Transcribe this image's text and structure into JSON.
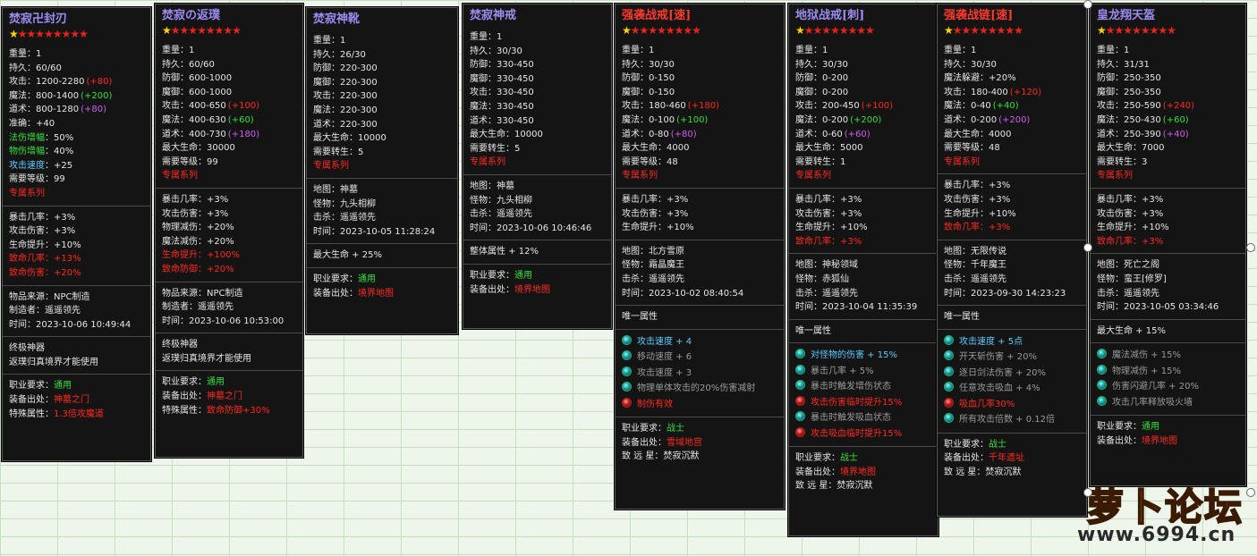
{
  "cards": [
    {
      "name": "焚寂卍封刃",
      "title_color": "purple",
      "stars": 9,
      "base": [
        {
          "k": "重量",
          "v": "1"
        },
        {
          "k": "持久",
          "v": "60/60"
        },
        {
          "k": "攻击",
          "v": "1200-2280",
          "b": "(+80)",
          "bc": "r"
        },
        {
          "k": "魔法",
          "v": "800-1400",
          "b": "(+200)",
          "bc": "g"
        },
        {
          "k": "道术",
          "v": "800-1280",
          "b": "(+80)",
          "bc": "p"
        },
        {
          "k": "准确",
          "v": "+40"
        },
        {
          "k": "法伤增幅",
          "v": "50%",
          "kc": "g"
        },
        {
          "k": "物伤增幅",
          "v": "40%",
          "kc": "g"
        },
        {
          "k": "攻击速度",
          "v": "+25",
          "kc": "c"
        },
        {
          "k": "需要等级",
          "v": "99"
        }
      ],
      "series": "专属系列",
      "bonus": [
        {
          "t": "暴击几率：+3%"
        },
        {
          "t": "攻击伤害：+3%"
        },
        {
          "t": "生命提升：+10%"
        },
        {
          "t": "致命几率：+13%",
          "c": "r"
        },
        {
          "t": "致命伤害：+20%",
          "c": "r"
        }
      ],
      "source": [
        "物品来源：NPC制造",
        "制造者：遥遥领先",
        "时间：2023-10-06 10:49:44"
      ],
      "extra": [
        "终极神器",
        "返璞归真境界才能使用"
      ],
      "req": [
        {
          "k": "职业要求：",
          "v": "通用",
          "c": "g"
        },
        {
          "k": "装备出处：",
          "v": "神墓之门",
          "c": "r"
        },
        {
          "k": "特殊属性：",
          "v": "1.3倍攻魔道",
          "c": "r"
        }
      ]
    },
    {
      "name": "焚寂の返璞",
      "title_color": "purple",
      "stars": 9,
      "base": [
        {
          "k": "重量",
          "v": "1"
        },
        {
          "k": "持久",
          "v": "60/60"
        },
        {
          "k": "防御",
          "v": "600-1000"
        },
        {
          "k": "魔御",
          "v": "600-1000"
        },
        {
          "k": "攻击",
          "v": "400-650",
          "b": "(+100)",
          "bc": "r"
        },
        {
          "k": "魔法",
          "v": "400-630",
          "b": "(+60)",
          "bc": "g"
        },
        {
          "k": "道术",
          "v": "400-730",
          "b": "(+180)",
          "bc": "p"
        },
        {
          "k": "最大生命",
          "v": "30000"
        },
        {
          "k": "需要等级",
          "v": "99"
        }
      ],
      "series": "专属系列",
      "bonus": [
        {
          "t": "暴击几率：+3%"
        },
        {
          "t": "攻击伤害：+3%"
        },
        {
          "t": "物理减伤：+20%"
        },
        {
          "t": "魔法减伤：+20%"
        },
        {
          "t": "生命提升：+100%",
          "c": "r"
        },
        {
          "t": "致命防御：+20%",
          "c": "r"
        }
      ],
      "source": [
        "物品来源：NPC制造",
        "制造者：遥遥领先",
        "时间：2023-10-06 10:53:00"
      ],
      "extra": [
        "终极神器",
        "返璞归真境界才能使用"
      ],
      "req": [
        {
          "k": "职业要求：",
          "v": "通用",
          "c": "g"
        },
        {
          "k": "装备出处：",
          "v": "神墓之门",
          "c": "r"
        },
        {
          "k": "特殊属性：",
          "v": "致命防御+30%",
          "c": "r"
        }
      ]
    },
    {
      "name": "焚寂神靴",
      "title_color": "purple",
      "stars": 0,
      "base": [
        {
          "k": "重量",
          "v": "1"
        },
        {
          "k": "持久",
          "v": "26/30"
        },
        {
          "k": "防御",
          "v": "220-300"
        },
        {
          "k": "魔御",
          "v": "220-300"
        },
        {
          "k": "攻击",
          "v": "220-300"
        },
        {
          "k": "魔法",
          "v": "220-300"
        },
        {
          "k": "道术",
          "v": "220-300"
        },
        {
          "k": "最大生命",
          "v": "10000"
        },
        {
          "k": "需要转生",
          "v": "5"
        }
      ],
      "series": "专属系列",
      "source": [
        "地图：神墓",
        "怪物：九头相柳",
        "击杀：遥遥领先",
        "时间：2023-10-05 11:28:24"
      ],
      "extra": [
        "最大生命 + 25%"
      ],
      "req": [
        {
          "k": "职业要求：",
          "v": "通用",
          "c": "g"
        },
        {
          "k": "装备出处：",
          "v": "境界地图",
          "c": "r"
        }
      ]
    },
    {
      "name": "焚寂神戒",
      "title_color": "purple",
      "stars": 0,
      "base": [
        {
          "k": "重量",
          "v": "1"
        },
        {
          "k": "持久",
          "v": "30/30"
        },
        {
          "k": "防御",
          "v": "330-450"
        },
        {
          "k": "魔御",
          "v": "330-450"
        },
        {
          "k": "攻击",
          "v": "330-450"
        },
        {
          "k": "魔法",
          "v": "330-450"
        },
        {
          "k": "道术",
          "v": "330-450"
        },
        {
          "k": "最大生命",
          "v": "10000"
        },
        {
          "k": "需要转生",
          "v": "5"
        }
      ],
      "series": "专属系列",
      "source": [
        "地图：神墓",
        "怪物：九头相柳",
        "击杀：遥遥领先",
        "时间：2023-10-06 10:46:46"
      ],
      "extra": [
        "整体属性 + 12%"
      ],
      "req": [
        {
          "k": "职业要求：",
          "v": "通用",
          "c": "g"
        },
        {
          "k": "装备出处：",
          "v": "境界地图",
          "c": "r"
        }
      ]
    },
    {
      "name": "强袭战戒[速]",
      "title_color": "red",
      "stars": 9,
      "base": [
        {
          "k": "重量",
          "v": "1"
        },
        {
          "k": "持久",
          "v": "30/30"
        },
        {
          "k": "防御",
          "v": "0-150"
        },
        {
          "k": "魔御",
          "v": "0-150"
        },
        {
          "k": "攻击",
          "v": "180-460",
          "b": "(+180)",
          "bc": "r"
        },
        {
          "k": "魔法",
          "v": "0-100",
          "b": "(+100)",
          "bc": "g"
        },
        {
          "k": "道术",
          "v": "0-80",
          "b": "(+80)",
          "bc": "p"
        },
        {
          "k": "最大生命",
          "v": "4000"
        },
        {
          "k": "需要等级",
          "v": "48"
        }
      ],
      "series": "专属系列",
      "bonus": [
        {
          "t": "暴击几率：+3%"
        },
        {
          "t": "攻击伤害：+3%"
        },
        {
          "t": "生命提升：+10%"
        }
      ],
      "source": [
        "地图：北方雪原",
        "怪物：霜晶魔王",
        "击杀：遥遥领先",
        "时间：2023-10-02 08:40:54"
      ],
      "unique_label": "唯一属性",
      "unique": [
        {
          "t": "攻击速度 + 4",
          "c": "c"
        },
        {
          "t": "移动速度 + 6",
          "c": "gr"
        },
        {
          "t": "攻击速度 + 3",
          "c": "gr"
        },
        {
          "t": "物理单体攻击的20%伤害减射",
          "c": "gr"
        },
        {
          "t": "制伤有效",
          "c": "r",
          "dot": "rd"
        }
      ],
      "req": [
        {
          "k": "职业要求：",
          "v": "战士",
          "c": "g"
        },
        {
          "k": "装备出处：",
          "v": "雪域地宫",
          "c": "r"
        },
        {
          "k": "致 远 星：",
          "v": "焚寂沉默",
          "c": "w"
        }
      ]
    },
    {
      "name": "地狱战戒[刺]",
      "title_color": "purple",
      "stars": 9,
      "base": [
        {
          "k": "重量",
          "v": "1"
        },
        {
          "k": "持久",
          "v": "30/30"
        },
        {
          "k": "防御",
          "v": "0-200"
        },
        {
          "k": "魔御",
          "v": "0-200"
        },
        {
          "k": "攻击",
          "v": "200-450",
          "b": "(+100)",
          "bc": "r"
        },
        {
          "k": "魔法",
          "v": "0-200",
          "b": "(+200)",
          "bc": "g"
        },
        {
          "k": "道术",
          "v": "0-60",
          "b": "(+60)",
          "bc": "p"
        },
        {
          "k": "最大生命",
          "v": "5000"
        },
        {
          "k": "需要转生",
          "v": "1"
        }
      ],
      "series": "专属系列",
      "bonus": [
        {
          "t": "暴击几率：+3%"
        },
        {
          "t": "攻击伤害：+3%"
        },
        {
          "t": "生命提升：+10%"
        },
        {
          "t": "致命几率：+3%",
          "c": "r"
        }
      ],
      "source": [
        "地图：神秘领域",
        "怪物：赤狐仙",
        "击杀：遥遥领先",
        "时间：2023-10-04 11:35:39"
      ],
      "unique_label": "唯一属性",
      "unique": [
        {
          "t": "对怪物的伤害 + 15%",
          "c": "c"
        },
        {
          "t": "暴击几率 + 5%",
          "c": "gr"
        },
        {
          "t": "暴击时触发增伤状态",
          "c": "gr"
        },
        {
          "t": "攻击伤害临时提升15%",
          "c": "r",
          "dot": "rd"
        },
        {
          "t": "暴击时触发吸血状态",
          "c": "gr"
        },
        {
          "t": "攻击吸血临时提升15%",
          "c": "r",
          "dot": "rd"
        }
      ],
      "req": [
        {
          "k": "职业要求：",
          "v": "战士",
          "c": "g"
        },
        {
          "k": "装备出处：",
          "v": "境界地图",
          "c": "r"
        },
        {
          "k": "致 远 星：",
          "v": "焚寂沉默",
          "c": "w"
        }
      ]
    },
    {
      "name": "强袭战链[速]",
      "title_color": "red",
      "stars": 9,
      "base": [
        {
          "k": "重量",
          "v": "1"
        },
        {
          "k": "持久",
          "v": "30/30"
        },
        {
          "k": "魔法躲避",
          "v": "+20%"
        },
        {
          "k": "攻击",
          "v": "180-400",
          "b": "(+120)",
          "bc": "r"
        },
        {
          "k": "魔法",
          "v": "0-40",
          "b": "(+40)",
          "bc": "g"
        },
        {
          "k": "道术",
          "v": "0-200",
          "b": "(+200)",
          "bc": "p"
        },
        {
          "k": "最大生命",
          "v": "4000"
        },
        {
          "k": "需要等级",
          "v": "48"
        }
      ],
      "series": "专属系列",
      "bonus": [
        {
          "t": "暴击几率：+3%"
        },
        {
          "t": "攻击伤害：+3%"
        },
        {
          "t": "生命提升：+10%"
        },
        {
          "t": "致命几率：+3%",
          "c": "r"
        }
      ],
      "source": [
        "地图：无限传说",
        "怪物：千年魔王",
        "击杀：遥遥领先",
        "时间：2023-09-30 14:23:23"
      ],
      "unique_label": "唯一属性",
      "unique": [
        {
          "t": "攻击速度 + 5点",
          "c": "c"
        },
        {
          "t": "开天斩伤害 + 20%",
          "c": "gr"
        },
        {
          "t": "逐日剑法伤害 + 20%",
          "c": "gr"
        },
        {
          "t": "任意攻击吸血 + 4%",
          "c": "gr"
        },
        {
          "t": "吸血几率30%",
          "c": "r",
          "dot": "rd"
        },
        {
          "t": "所有攻击倍数 + 0.12倍",
          "c": "gr"
        }
      ],
      "req": [
        {
          "k": "职业要求：",
          "v": "战士",
          "c": "g"
        },
        {
          "k": "装备出处：",
          "v": "千年遗址",
          "c": "r"
        },
        {
          "k": "致 远 星：",
          "v": "焚寂沉默",
          "c": "w"
        }
      ]
    },
    {
      "name": "皇龙翔天盔",
      "title_color": "purple",
      "stars": 9,
      "base": [
        {
          "k": "重量",
          "v": "1"
        },
        {
          "k": "持久",
          "v": "31/31"
        },
        {
          "k": "防御",
          "v": "250-350"
        },
        {
          "k": "魔御",
          "v": "250-350"
        },
        {
          "k": "攻击",
          "v": "250-590",
          "b": "(+240)",
          "bc": "r"
        },
        {
          "k": "魔法",
          "v": "250-430",
          "b": "(+60)",
          "bc": "g"
        },
        {
          "k": "道术",
          "v": "250-390",
          "b": "(+40)",
          "bc": "p"
        },
        {
          "k": "最大生命",
          "v": "7000"
        },
        {
          "k": "需要转生",
          "v": "3"
        }
      ],
      "series": "专属系列",
      "bonus": [
        {
          "t": "暴击几率：+3%"
        },
        {
          "t": "攻击伤害：+3%"
        },
        {
          "t": "生命提升：+10%"
        },
        {
          "t": "致命几率：+3%",
          "c": "r"
        }
      ],
      "source": [
        "地图：死亡之阁",
        "怪物：蛮王[修罗]",
        "击杀：遥遥领先",
        "时间：2023-10-05 03:34:46"
      ],
      "extra": [
        "最大生命 + 15%"
      ],
      "unique": [
        {
          "t": "魔法减伤 + 15%",
          "c": "gr"
        },
        {
          "t": "物理减伤 + 15%",
          "c": "gr"
        },
        {
          "t": "伤害闪避几率 + 20%",
          "c": "gr"
        },
        {
          "t": "攻击几率释放吸火墙",
          "c": "gr",
          "tail": "吸火墙",
          "tc": "r"
        }
      ],
      "req": [
        {
          "k": "职业要求：",
          "v": "通用",
          "c": "g"
        },
        {
          "k": "装备出处：",
          "v": "境界地图",
          "c": "r"
        }
      ]
    }
  ],
  "logo": {
    "text": "萝卜论坛",
    "url": "www.6994.cn"
  }
}
